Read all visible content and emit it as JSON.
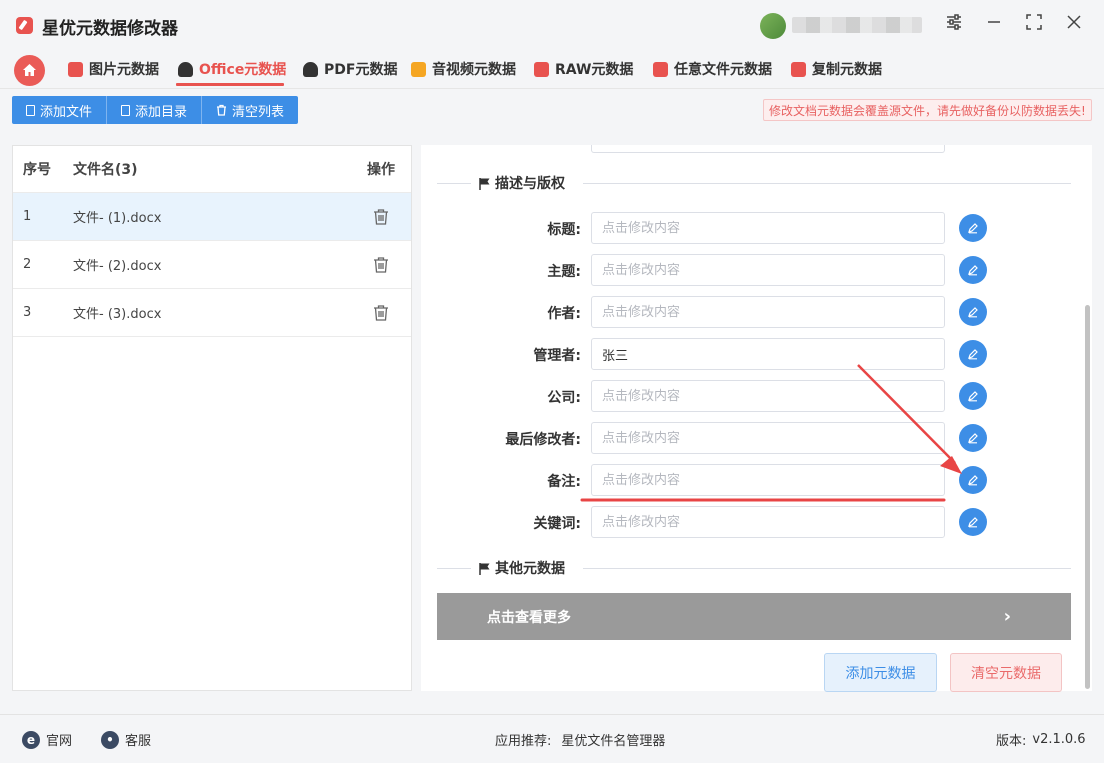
{
  "app": {
    "title": "星优元数据修改器"
  },
  "tabs": [
    {
      "label": "图片元数据",
      "icon": "image-tab-icon",
      "color": "#e8534f"
    },
    {
      "label": "Office元数据",
      "icon": "office-tab-icon",
      "color": "#333333",
      "active": true
    },
    {
      "label": "PDF元数据",
      "icon": "pdf-tab-icon",
      "color": "#333333"
    },
    {
      "label": "音视频元数据",
      "icon": "media-tab-icon",
      "color": "#f5a623"
    },
    {
      "label": "RAW元数据",
      "icon": "raw-tab-icon",
      "color": "#e8534f"
    },
    {
      "label": "任意文件元数据",
      "icon": "anyfile-tab-icon",
      "color": "#e8534f"
    },
    {
      "label": "复制元数据",
      "icon": "copy-tab-icon",
      "color": "#e8534f"
    }
  ],
  "toolbar": {
    "add_file": "添加文件",
    "add_dir": "添加目录",
    "clear_list": "清空列表"
  },
  "warning": "修改文档元数据会覆盖源文件，请先做好备份以防数据丢失!",
  "file_table": {
    "headers": {
      "num": "序号",
      "name": "文件名(3)",
      "op": "操作"
    },
    "rows": [
      {
        "num": "1",
        "name": "文件- (1).docx",
        "selected": true
      },
      {
        "num": "2",
        "name": "文件- (2).docx"
      },
      {
        "num": "3",
        "name": "文件- (3).docx"
      }
    ]
  },
  "sections": {
    "desc": "描述与版权",
    "other": "其他元数据"
  },
  "fields": [
    {
      "label": "标题:",
      "value": "",
      "placeholder": "点击修改内容"
    },
    {
      "label": "主题:",
      "value": "",
      "placeholder": "点击修改内容"
    },
    {
      "label": "作者:",
      "value": "",
      "placeholder": "点击修改内容"
    },
    {
      "label": "管理者:",
      "value": "张三",
      "placeholder": "点击修改内容"
    },
    {
      "label": "公司:",
      "value": "",
      "placeholder": "点击修改内容"
    },
    {
      "label": "最后修改者:",
      "value": "",
      "placeholder": "点击修改内容"
    },
    {
      "label": "备注:",
      "value": "",
      "placeholder": "点击修改内容"
    },
    {
      "label": "关键词:",
      "value": "",
      "placeholder": "点击修改内容"
    }
  ],
  "more_label": "点击查看更多",
  "actions": {
    "add": "添加元数据",
    "clear": "清空元数据"
  },
  "footer": {
    "website": "官网",
    "service": "客服",
    "recommend_label": "应用推荐:",
    "recommend_app": "星优文件名管理器",
    "version_label": "版本:",
    "version": "v2.1.0.6"
  },
  "colors": {
    "accent": "#e8534f",
    "primary": "#3d8ee6",
    "annotation": "#e84545"
  }
}
